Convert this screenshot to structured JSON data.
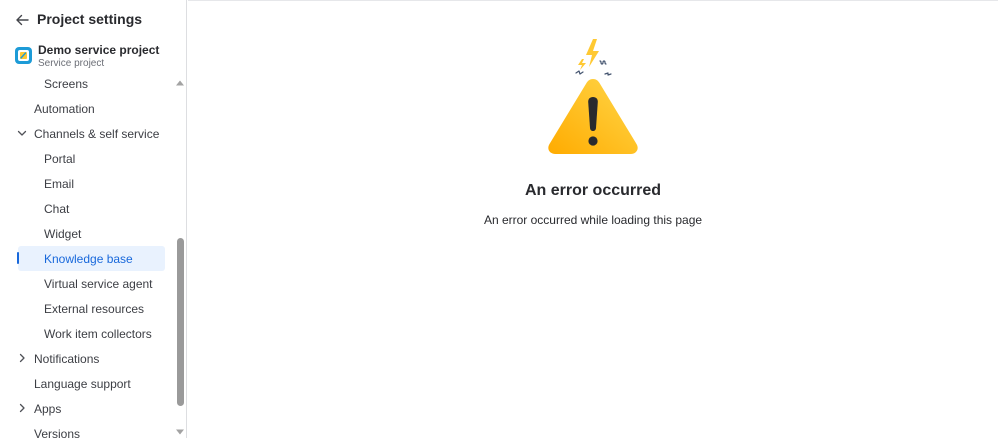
{
  "sidebar": {
    "title": "Project settings",
    "project": {
      "name": "Demo service project",
      "type": "Service project"
    },
    "items": [
      {
        "label": "Screens"
      },
      {
        "label": "Automation"
      },
      {
        "label": "Channels & self service"
      },
      {
        "label": "Portal"
      },
      {
        "label": "Email"
      },
      {
        "label": "Chat"
      },
      {
        "label": "Widget"
      },
      {
        "label": "Knowledge base"
      },
      {
        "label": "Virtual service agent"
      },
      {
        "label": "External resources"
      },
      {
        "label": "Work item collectors"
      },
      {
        "label": "Notifications"
      },
      {
        "label": "Language support"
      },
      {
        "label": "Apps"
      },
      {
        "label": "Versions"
      }
    ]
  },
  "main": {
    "error_title": "An error occurred",
    "error_description": "An error occurred while loading this page"
  },
  "colors": {
    "accent": "#1868DB",
    "active_bg": "#E9F2FE",
    "warning_yellow": "#FFC933",
    "warning_orange": "#FFAB00",
    "text": "#292A2E"
  },
  "icons": {
    "back": "arrow-left-icon",
    "project": "service-project-icon",
    "chevron_down": "chevron-down-icon",
    "chevron_right": "chevron-right-icon",
    "warning": "warning-triangle-icon"
  }
}
